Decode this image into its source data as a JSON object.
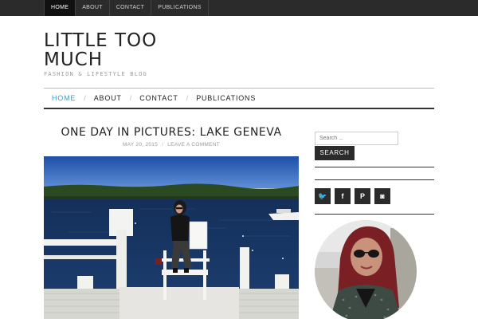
{
  "topnav": {
    "items": [
      {
        "label": "Home",
        "active": true
      },
      {
        "label": "About",
        "active": false
      },
      {
        "label": "Contact",
        "active": false
      },
      {
        "label": "Publications",
        "active": false
      }
    ]
  },
  "site": {
    "title": "LITTLE TOO MUCH",
    "tagline": "FASHION & LIFESTYLE BLOG"
  },
  "mainnav": {
    "items": [
      {
        "label": "Home",
        "active": true
      },
      {
        "label": "About",
        "active": false
      },
      {
        "label": "Contact",
        "active": false
      },
      {
        "label": "Publications",
        "active": false
      }
    ]
  },
  "post": {
    "title": "ONE DAY IN PICTURES: LAKE GENEVA",
    "date": "MAY 20, 2015",
    "comment_link": "LEAVE A COMMENT"
  },
  "sidebar": {
    "search_placeholder": "Search ...",
    "search_button": "Search",
    "socials": [
      {
        "icon": "twitter-icon",
        "glyph": "🐦"
      },
      {
        "icon": "facebook-icon",
        "glyph": "f"
      },
      {
        "icon": "pinterest-icon",
        "glyph": "P"
      },
      {
        "icon": "instagram-icon",
        "glyph": "◙"
      }
    ]
  },
  "colors": {
    "accent": "#3a9fc7",
    "dark": "#2b2b2b"
  }
}
